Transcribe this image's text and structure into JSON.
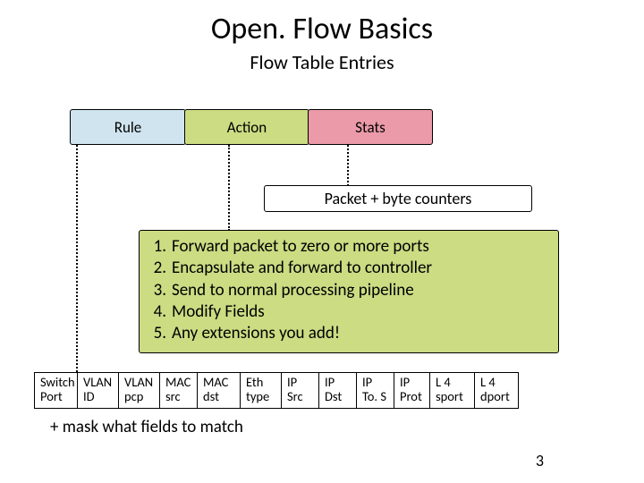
{
  "title": "Open. Flow Basics",
  "subtitle": "Flow Table Entries",
  "tri": {
    "rule": "Rule",
    "action": "Action",
    "stats": "Stats"
  },
  "counters": "Packet + byte counters",
  "actions": [
    {
      "n": "1.",
      "t": "Forward packet to zero or more ports"
    },
    {
      "n": "2.",
      "t": "Encapsulate and forward to controller"
    },
    {
      "n": "3.",
      "t": "Send to normal processing pipeline"
    },
    {
      "n": "4.",
      "t": "Modify Fields"
    },
    {
      "n": "5.",
      "t": "Any extensions you add!"
    }
  ],
  "fields": [
    {
      "l1": "Switch",
      "l2": "Port"
    },
    {
      "l1": "VLAN",
      "l2": "ID"
    },
    {
      "l1": "VLAN",
      "l2": "pcp"
    },
    {
      "l1": "MAC",
      "l2": "src"
    },
    {
      "l1": "MAC",
      "l2": "dst"
    },
    {
      "l1": "Eth",
      "l2": "type"
    },
    {
      "l1": "IP",
      "l2": "Src"
    },
    {
      "l1": "IP",
      "l2": "Dst"
    },
    {
      "l1": "IP",
      "l2": "To. S"
    },
    {
      "l1": "IP",
      "l2": "Prot"
    },
    {
      "l1": "L 4",
      "l2": "sport"
    },
    {
      "l1": "L 4",
      "l2": "dport"
    }
  ],
  "mask_note": "+ mask what fields to match",
  "page": "3"
}
